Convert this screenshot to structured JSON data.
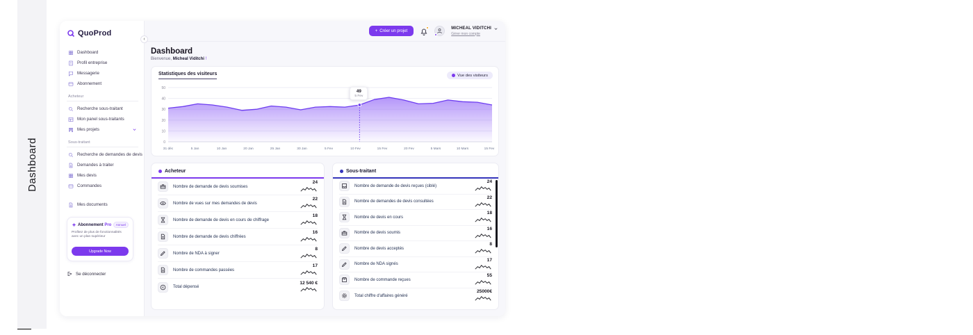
{
  "window_tab": {
    "label": "Dashboard"
  },
  "brand": {
    "name": "QuoProd"
  },
  "sidebar": {
    "main_items": [
      {
        "label": "Dashboard"
      },
      {
        "label": "Profil entreprise"
      },
      {
        "label": "Messagerie"
      },
      {
        "label": "Abonnement"
      }
    ],
    "section_acheteur": {
      "label": "Acheteur",
      "items": [
        {
          "label": "Recherche sous-traitant"
        },
        {
          "label": "Mon panel sous-traitants"
        },
        {
          "label": "Mes projets"
        }
      ]
    },
    "section_soustraitant": {
      "label": "Sous-traitant",
      "items": [
        {
          "label": "Recherche de demandes de devis"
        },
        {
          "label": "Demandes à traiter"
        },
        {
          "label": "Mes devis"
        },
        {
          "label": "Commandes"
        }
      ]
    },
    "documents_item": {
      "label": "Mes documents"
    },
    "subscription": {
      "title_prefix": "Abonnement ",
      "title_highlight": "Pro",
      "badge": "Annuel",
      "description": "Profitez de plus de fonctionnalités avec un plan supérieur",
      "button": "Upgrade Now"
    },
    "logout_label": "Se déconnecter",
    "collapse_glyph": "‹"
  },
  "header": {
    "create_button_label": "Créer un projet",
    "user_name": "MICHEAL VIDITCHI",
    "account_link": "Gérer mon compte"
  },
  "page": {
    "title": "Dashboard",
    "welcome_prefix": "Bienvenue, ",
    "welcome_name": "Micheal Viditchi",
    "welcome_suffix": " !"
  },
  "chart_card": {
    "title": "Statistiques des visiteurs",
    "legend_label": "Vue des visiteurs"
  },
  "chart_data": {
    "type": "area",
    "title": "Statistiques des visiteurs",
    "legend": [
      "Vue des visiteurs"
    ],
    "legend_position": "top-right",
    "grid": true,
    "ylim": [
      0,
      50
    ],
    "y_ticks": [
      0,
      10,
      20,
      30,
      40,
      50
    ],
    "x_tick_labels": [
      "31 déc",
      "5 Jan",
      "10 Jan",
      "20 Jan",
      "25 Jan",
      "30 Jan",
      "5 Fev",
      "10 Fev",
      "15 Fev",
      "20 Fev",
      "5 Mars",
      "10 Mars",
      "15 Fev"
    ],
    "series": [
      {
        "name": "Vue des visiteurs",
        "values": [
          31,
          32.5,
          35,
          34,
          32,
          29,
          30,
          33,
          32,
          29.5,
          32,
          32.5,
          32,
          34,
          39,
          41,
          38.5,
          35,
          35.5,
          38.5,
          37,
          36.5,
          34
        ]
      }
    ],
    "highlight": {
      "index": 13,
      "value": "49",
      "label": "5 Fev"
    }
  },
  "panels": {
    "acheteur": {
      "title": "Acheteur",
      "rows": [
        {
          "icon": "briefcase-icon",
          "label": "Nombre de demande de devis soumises",
          "value": "24"
        },
        {
          "icon": "eye-icon",
          "label": "Nombre de vues sur mes demandes de devis",
          "value": "22"
        },
        {
          "icon": "hourglass-icon",
          "label": "Nombre de demande de devis en cours de chiffrage",
          "value": "18"
        },
        {
          "icon": "document-icon",
          "label": "Nombre de demande de devis chiffrées",
          "value": "16"
        },
        {
          "icon": "signature-icon",
          "label": "Nombre de NDA à signer",
          "value": "8"
        },
        {
          "icon": "document-icon",
          "label": "Nombre de commandes passées",
          "value": "17"
        },
        {
          "icon": "euro-icon",
          "label": "Total dépensé",
          "value": "12 540 €"
        }
      ]
    },
    "sous_traitant": {
      "title": "Sous-traitant",
      "rows": [
        {
          "icon": "inbox-icon",
          "label": "Nombre de demande de devis reçues (ciblé)",
          "value": "24"
        },
        {
          "icon": "document-icon",
          "label": "Nombre de demandes de devis consultées",
          "value": "22"
        },
        {
          "icon": "hourglass-icon",
          "label": "Nombre de devis en cours",
          "value": "18"
        },
        {
          "icon": "briefcase-icon",
          "label": "Nombre de devis soumis",
          "value": "16"
        },
        {
          "icon": "signature-icon",
          "label": "Nombre de devis acceptés",
          "value": "8"
        },
        {
          "icon": "signature-icon",
          "label": "Nombre de NDA signés",
          "value": "17"
        },
        {
          "icon": "box-icon",
          "label": "Nombre de commande reçues",
          "value": "55"
        },
        {
          "icon": "gear-icon",
          "label": "Total chiffre d'affaires généré",
          "value": "25000€"
        }
      ]
    }
  },
  "colors": {
    "accent_purple": "#7c3aed",
    "chart_line": "#6d3df0",
    "chart_fill": "#8b5cf6",
    "acheteur_accent": "#7c3aed",
    "sous_traitant_accent": "#3434bb",
    "notification_badge": "#f59e0b",
    "card_background": "#f7f7fb"
  }
}
